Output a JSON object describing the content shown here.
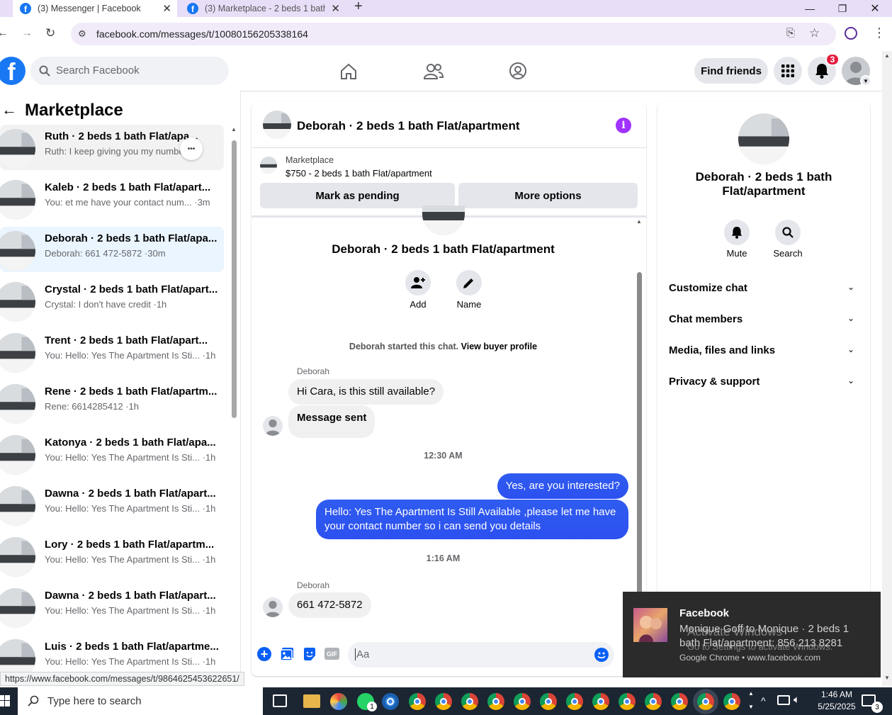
{
  "browser": {
    "tabs": [
      {
        "title": "(3) Messenger | Facebook"
      },
      {
        "title": "(3) Marketplace - 2 beds 1 bath"
      }
    ],
    "url": "facebook.com/messages/t/10080156205338164",
    "status_url": "https://www.facebook.com/messages/t/9864625453622651/"
  },
  "header": {
    "search_placeholder": "Search Facebook",
    "find_friends": "Find friends",
    "notifications_count": "3"
  },
  "left": {
    "title": "Marketplace",
    "conversations": [
      {
        "name": "Ruth · 2 beds 1 bath Flat/apa...",
        "preview": "Ruth: I keep giving you my numbe... m"
      },
      {
        "name": "Kaleb · 2 beds 1 bath Flat/apart...",
        "preview": "You: et me have your contact num... ·3m"
      },
      {
        "name": "Deborah · 2 beds 1 bath Flat/apa...",
        "preview": "Deborah: 661 472-5872 ·30m"
      },
      {
        "name": "Crystal · 2 beds 1 bath Flat/apart...",
        "preview": "Crystal: I don't have credit ·1h"
      },
      {
        "name": "Trent · 2 beds 1 bath Flat/apart...",
        "preview": "You: Hello: Yes The Apartment Is Sti... ·1h"
      },
      {
        "name": "Rene · 2 beds 1 bath Flat/apartm...",
        "preview": "Rene: 6614285412 ·1h"
      },
      {
        "name": "Katonya · 2 beds 1 bath Flat/apa...",
        "preview": "You: Hello: Yes The Apartment Is Sti... ·1h"
      },
      {
        "name": "Dawna · 2 beds 1 bath Flat/apart...",
        "preview": "You: Hello: Yes The Apartment Is Sti... ·1h"
      },
      {
        "name": "Lory · 2 beds 1 bath Flat/apartm...",
        "preview": "You: Hello: Yes The Apartment Is Sti... ·1h"
      },
      {
        "name": "Dawna · 2 beds 1 bath Flat/apart...",
        "preview": "You: Hello: Yes The Apartment Is Sti... ·1h"
      },
      {
        "name": "Luis · 2 beds 1 bath Flat/apartme...",
        "preview": "You: Hello: Yes The Apartment Is Sti... ·1h"
      }
    ]
  },
  "chat": {
    "title": "Deborah · 2 beds 1 bath Flat/apartment",
    "listing_source": "Marketplace",
    "listing_price": "$750 - 2 beds 1 bath Flat/apartment",
    "mark_pending": "Mark as pending",
    "more_options": "More options",
    "profile_name": "Deborah · 2 beds 1 bath Flat/apartment",
    "add_label": "Add",
    "name_label": "Name",
    "started_text": "Deborah started this chat.",
    "view_profile": "View buyer profile",
    "sender1": "Deborah",
    "msg1": "Hi Cara, is this still available?",
    "msg2": "Message sent",
    "time1": "12:30 AM",
    "msg3": "Yes, are you interested?",
    "msg4": "Hello: Yes The Apartment Is Still Available ,please let me have your contact number so i can send you details",
    "time2": "1:16 AM",
    "sender2": "Deborah",
    "msg5": "661 472-5872",
    "composer_placeholder": "Aa"
  },
  "right": {
    "name": "Deborah · 2 beds 1 bath Flat/apartment",
    "mute": "Mute",
    "search": "Search",
    "sections": [
      "Customize chat",
      "Chat members",
      "Media, files and links",
      "Privacy & support"
    ]
  },
  "toast": {
    "title": "Facebook",
    "body": "Monique Goff to Monique · 2 beds 1 bath Flat/apartment: 856 213 8281",
    "source": "Google Chrome • www.facebook.com",
    "watermark1": "Activate Windows",
    "watermark2": "Go to Settings to activate Windows."
  },
  "taskbar": {
    "search_placeholder": "Type here to search",
    "time": "1:46 AM",
    "date": "5/25/2025",
    "notif_count": "3"
  },
  "colors": {
    "fb_blue": "#1877f2",
    "messenger_blue": "#0a60f5",
    "info_purple": "#a033ff",
    "badge_red": "#e41e3f"
  }
}
